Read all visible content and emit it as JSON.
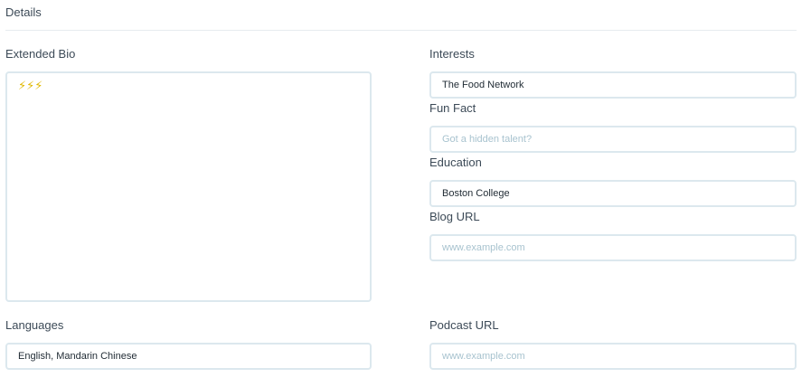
{
  "details": {
    "title": "Details"
  },
  "extended_bio": {
    "label": "Extended Bio",
    "value": "⚡⚡⚡"
  },
  "interests": {
    "label": "Interests",
    "value": "The Food Network"
  },
  "fun_fact": {
    "label": "Fun Fact",
    "value": "",
    "placeholder": "Got a hidden talent?"
  },
  "education": {
    "label": "Education",
    "value": "Boston College"
  },
  "blog_url": {
    "label": "Blog URL",
    "value": "",
    "placeholder": "www.example.com"
  },
  "languages": {
    "label": "Languages",
    "value": "English, Mandarin Chinese"
  },
  "podcast_url": {
    "label": "Podcast URL",
    "value": "",
    "placeholder": "www.example.com"
  },
  "colors": {
    "field_border": "#dce8ee",
    "placeholder": "#a8c3cf",
    "label_text": "#3c4a57",
    "bolt": "#e0b800"
  }
}
